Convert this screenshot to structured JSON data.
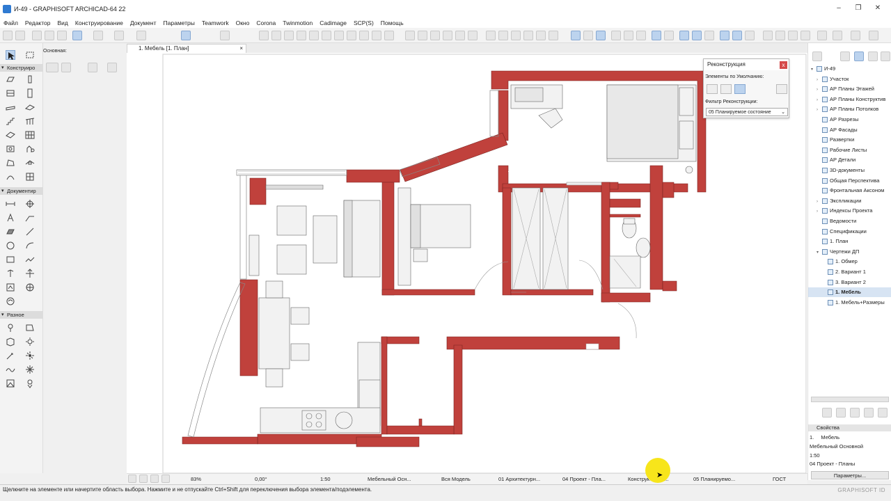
{
  "window": {
    "title": "И-49 - GRAPHISOFT ARCHICAD-64 22",
    "icon": "archicad-app-icon"
  },
  "menu": [
    "Файл",
    "Редактор",
    "Вид",
    "Конструирование",
    "Документ",
    "Параметры",
    "Teamwork",
    "Окно",
    "Corona",
    "Twinmotion",
    "Cadimage",
    "SCP(S)",
    "Помощь"
  ],
  "toolbox": {
    "categories": [
      "Конструиро",
      "Документир",
      "Разное"
    ],
    "info_label": "Основная:"
  },
  "tab": {
    "label": "1. Мебель [1. План]",
    "close": "×"
  },
  "renovation": {
    "title": "Реконструкция",
    "defaults_label": "Элементы по Умолчанию:",
    "filter_label": "Фильтр Реконструкции:",
    "filter_value": "05 Планируемое состояние",
    "close": "x"
  },
  "navigator": {
    "items": [
      {
        "label": "И-49",
        "level": 0,
        "tw": "▾"
      },
      {
        "label": "Участок",
        "level": 1,
        "tw": "›"
      },
      {
        "label": "АР Планы Этажей",
        "level": 1,
        "tw": "›"
      },
      {
        "label": "АР Планы Конструктив",
        "level": 1,
        "tw": "›"
      },
      {
        "label": "АР Планы Потолков",
        "level": 1,
        "tw": "›"
      },
      {
        "label": "АР Разрезы",
        "level": 1,
        "tw": ""
      },
      {
        "label": "АР Фасады",
        "level": 1,
        "tw": ""
      },
      {
        "label": "Развертки",
        "level": 1,
        "tw": ""
      },
      {
        "label": "Рабочие Листы",
        "level": 1,
        "tw": ""
      },
      {
        "label": "АР Детали",
        "level": 1,
        "tw": ""
      },
      {
        "label": "3D-документы",
        "level": 1,
        "tw": ""
      },
      {
        "label": "Общая Перспектива",
        "level": 1,
        "tw": ""
      },
      {
        "label": "Фронтальная Аксоном",
        "level": 1,
        "tw": ""
      },
      {
        "label": "Экспликации",
        "level": 1,
        "tw": "›"
      },
      {
        "label": "Индексы Проекта",
        "level": 1,
        "tw": "›"
      },
      {
        "label": "Ведомости",
        "level": 1,
        "tw": ""
      },
      {
        "label": "Спецификации",
        "level": 1,
        "tw": ""
      },
      {
        "label": "1. План",
        "level": 1,
        "tw": ""
      },
      {
        "label": "Чертежи ДП",
        "level": 1,
        "tw": "▾"
      },
      {
        "label": "1. Обмер",
        "level": 2,
        "tw": ""
      },
      {
        "label": "2. Вариант 1",
        "level": 2,
        "tw": ""
      },
      {
        "label": "3. Вариант 2",
        "level": 2,
        "tw": ""
      },
      {
        "label": "1. Мебель",
        "level": 2,
        "tw": "",
        "selected": true
      },
      {
        "label": "1. Мебель+Размеры",
        "level": 2,
        "tw": ""
      }
    ]
  },
  "properties": {
    "title": "Свойства",
    "id_prefix": "1.",
    "id_name": "Мебель",
    "layer_combo": "Мебельный Основной",
    "scale": "1:50",
    "structure": "04 Проект - Планы",
    "button": "Параметры..."
  },
  "quick_options": {
    "zoom": "83%",
    "angle": "0,00°",
    "scale": "1:50",
    "layer_combo": "Мебельный Осн...",
    "model_view": "Вся Модель",
    "pen_set": "01 Архитектурн...",
    "mvo": "04 Проект - Пла...",
    "structure_display": "Конструктивны...",
    "renovation_filter": "05 Планируемо...",
    "dim_standard": "ГОСТ"
  },
  "status": {
    "message": "Щелкните на элементе или начертите область выбора. Нажмите и не отпускайте Ctrl+Shift для переключения выбора элемента/подэлемента.",
    "logo": "GRAPHISOFT ID"
  },
  "colors": {
    "wall": "#c0413c",
    "accent": "#2f7ad1",
    "highlight": "#f7e51b"
  }
}
